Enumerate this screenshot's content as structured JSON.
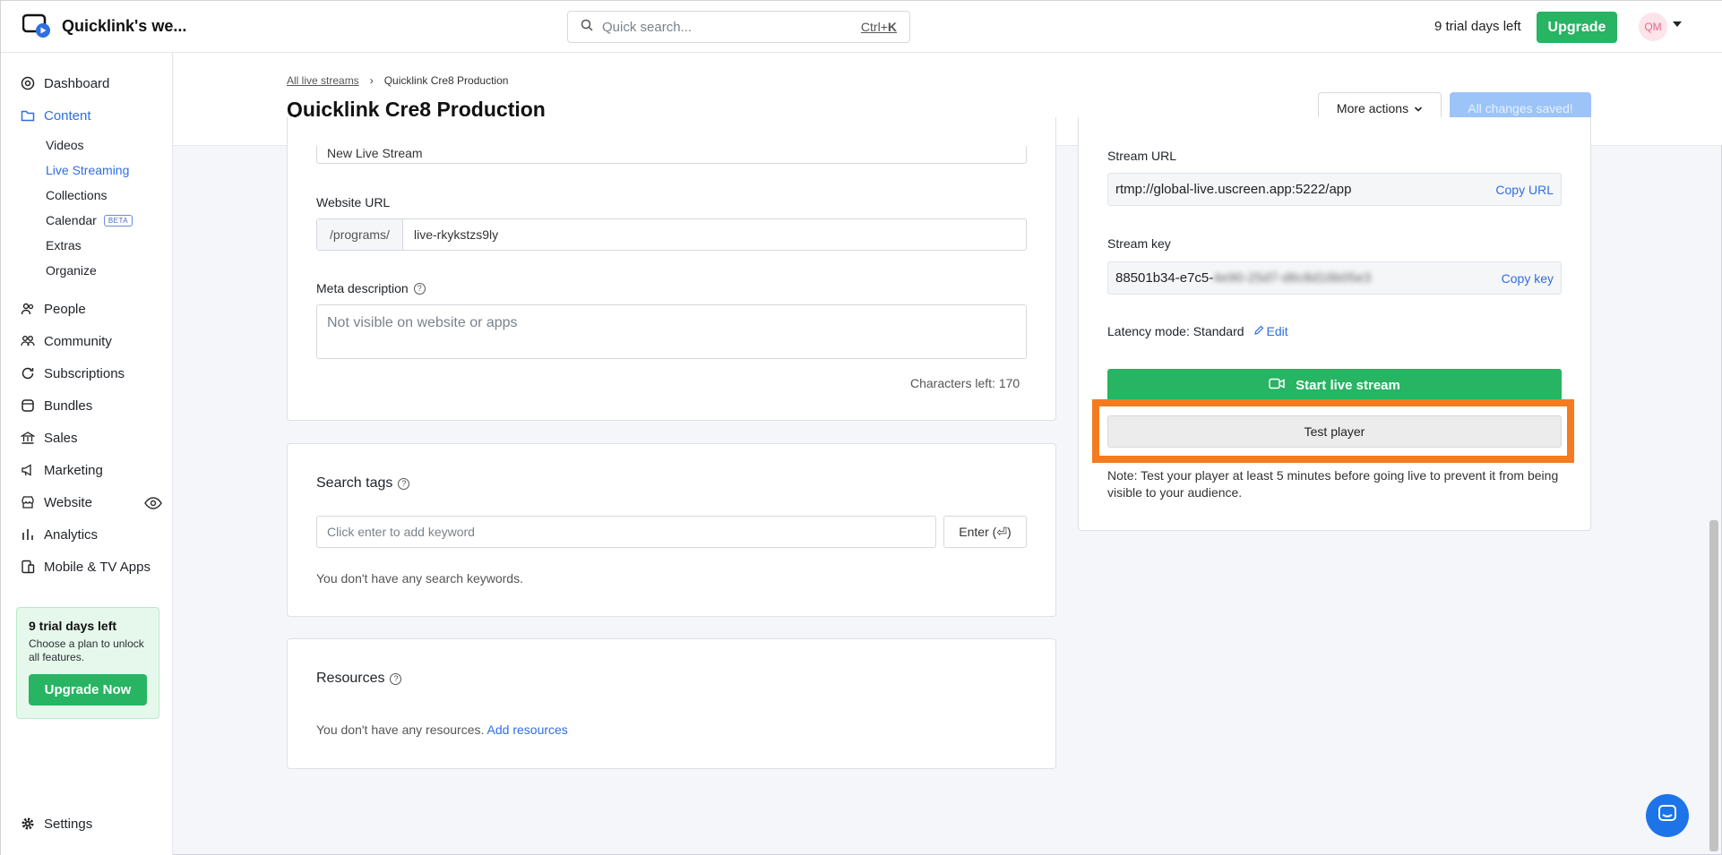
{
  "topbar": {
    "brand": "Quicklink's we...",
    "search_placeholder": "Quick search...",
    "search_shortcut_prefix": "Ctrl+",
    "search_shortcut_key": "K",
    "trial_text": "9 trial days left",
    "upgrade_label": "Upgrade",
    "avatar_initials": "QM"
  },
  "sidebar": {
    "items": [
      {
        "label": "Dashboard"
      },
      {
        "label": "Content"
      },
      {
        "label": "People"
      },
      {
        "label": "Community"
      },
      {
        "label": "Subscriptions"
      },
      {
        "label": "Bundles"
      },
      {
        "label": "Sales"
      },
      {
        "label": "Marketing"
      },
      {
        "label": "Website"
      },
      {
        "label": "Analytics"
      },
      {
        "label": "Mobile & TV Apps"
      }
    ],
    "content_sub": [
      "Videos",
      "Live Streaming",
      "Collections",
      "Calendar",
      "Extras",
      "Organize"
    ],
    "beta_badge": "BETA",
    "trial_card": {
      "title": "9 trial days left",
      "desc": "Choose a plan to unlock all features.",
      "button": "Upgrade Now"
    },
    "settings": "Settings"
  },
  "header": {
    "breadcrumb_link": "All live streams",
    "breadcrumb_sep": "›",
    "breadcrumb_current": "Quicklink Cre8 Production",
    "title": "Quicklink Cre8 Production",
    "more_actions": "More actions",
    "saved": "All changes saved!"
  },
  "details": {
    "title_value": "New Live Stream",
    "website_url_label": "Website URL",
    "url_prefix": "/programs/",
    "url_slug": "live-rkykstzs9ly",
    "meta_label": "Meta description",
    "meta_placeholder": "Not visible on website or apps",
    "chars_left": "Characters left: 170"
  },
  "tags": {
    "title": "Search tags",
    "placeholder": "Click enter to add keyword",
    "enter_btn": "Enter (⏎)",
    "empty": "You don't have any search keywords."
  },
  "resources": {
    "title": "Resources",
    "empty": "You don't have any resources.",
    "add": "Add resources"
  },
  "stream": {
    "url_label": "Stream URL",
    "url_value": "rtmp://global-live.uscreen.app:5222/app",
    "copy_url": "Copy URL",
    "key_label": "Stream key",
    "key_visible": "88501b34-e7c5-",
    "key_hidden": "4e90-25d7-d6c8d16b05e3",
    "copy_key": "Copy key",
    "latency": "Latency mode: Standard",
    "edit": "Edit",
    "start": "Start live stream",
    "test": "Test player",
    "note": "Note: Test your player at least 5 minutes before going live to prevent it from being visible to your audience."
  },
  "colors": {
    "accent_green": "#27b463",
    "accent_blue": "#2f6fe0",
    "highlight_orange": "#f47b20"
  }
}
